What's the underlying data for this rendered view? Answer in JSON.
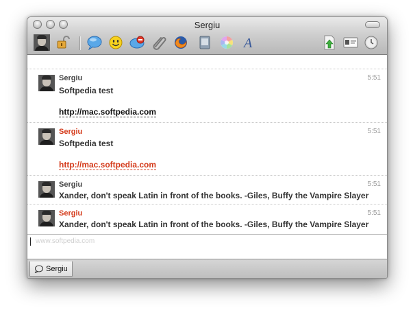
{
  "window": {
    "title": "Sergiu"
  },
  "toolbar": {
    "icons": [
      "avatar-icon",
      "lock-icon",
      "chat-bubble-icon",
      "smiley-icon",
      "block-icon",
      "paperclip-icon",
      "firefox-icon",
      "image-icon",
      "color-wheel-icon",
      "font-icon",
      "file-upload-icon",
      "contact-card-icon",
      "history-clock-icon"
    ]
  },
  "messages": [
    {
      "sender": "Sergiu",
      "time": "5:51",
      "text": "Softpedia test",
      "link": "http://mac.softpedia.com",
      "red": false
    },
    {
      "sender": "Sergiu",
      "time": "5:51",
      "text": "Softpedia test",
      "link": "http://mac.softpedia.com",
      "red": true
    },
    {
      "sender": "Sergiu",
      "time": "5:51",
      "text": "Xander, don't speak Latin in front of the books.  -Giles, Buffy the Vampire Slayer",
      "red": false
    },
    {
      "sender": "Sergiu",
      "time": "5:51",
      "text": "Xander, don't speak Latin in front of the books.  -Giles, Buffy the Vampire Slayer",
      "red": true
    }
  ],
  "input": {
    "watermark": "www.softpedia.com"
  },
  "tabs": [
    {
      "label": "Sergiu"
    }
  ],
  "colors": {
    "incoming_name": "#444444",
    "outgoing_name": "#d43a1a"
  }
}
